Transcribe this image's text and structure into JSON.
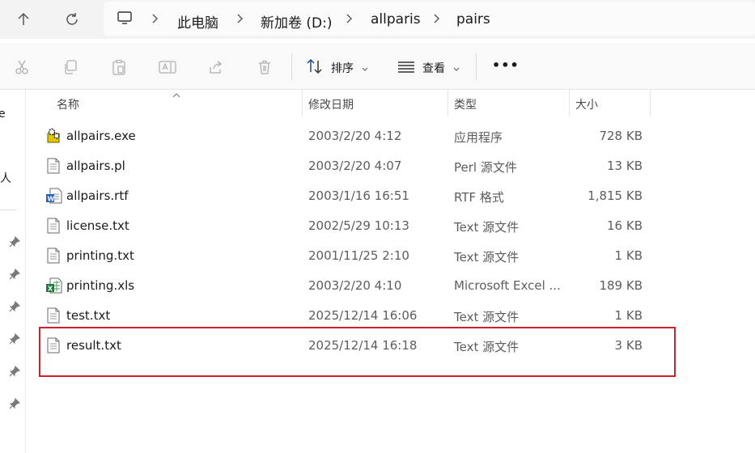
{
  "addressbar": {
    "crumbs": [
      "此电脑",
      "新加卷 (D:)",
      "allparis",
      "pairs"
    ]
  },
  "toolbar": {
    "sort_label": "排序",
    "view_label": "查看",
    "more_label": "•••"
  },
  "leftpane": {
    "partial_1": "e",
    "partial_2": "人"
  },
  "columns": {
    "name": "名称",
    "date": "修改日期",
    "type": "类型",
    "size": "大小"
  },
  "files": [
    {
      "name": "allpairs.exe",
      "date": "2003/2/20 4:12",
      "type": "应用程序",
      "size": "728 KB",
      "icon": "exe-icon"
    },
    {
      "name": "allpairs.pl",
      "date": "2003/2/20 4:07",
      "type": "Perl 源文件",
      "size": "13 KB",
      "icon": "text-file-icon"
    },
    {
      "name": "allpairs.rtf",
      "date": "2003/1/16 16:51",
      "type": "RTF 格式",
      "size": "1,815 KB",
      "icon": "word-doc-icon"
    },
    {
      "name": "license.txt",
      "date": "2002/5/29 10:13",
      "type": "Text 源文件",
      "size": "16 KB",
      "icon": "text-file-icon"
    },
    {
      "name": "printing.txt",
      "date": "2001/11/25 2:10",
      "type": "Text 源文件",
      "size": "1 KB",
      "icon": "text-file-icon"
    },
    {
      "name": "printing.xls",
      "date": "2003/2/20 4:10",
      "type": "Microsoft Excel ...",
      "size": "189 KB",
      "icon": "excel-icon"
    },
    {
      "name": "test.txt",
      "date": "2025/12/14 16:06",
      "type": "Text 源文件",
      "size": "1 KB",
      "icon": "text-file-icon"
    },
    {
      "name": "result.txt",
      "date": "2025/12/14 16:18",
      "type": "Text 源文件",
      "size": "3 KB",
      "icon": "text-file-icon"
    }
  ],
  "colors": {
    "highlight": "#d0202a",
    "excel_green": "#1f7a3f",
    "word_blue": "#2b5fbf"
  }
}
